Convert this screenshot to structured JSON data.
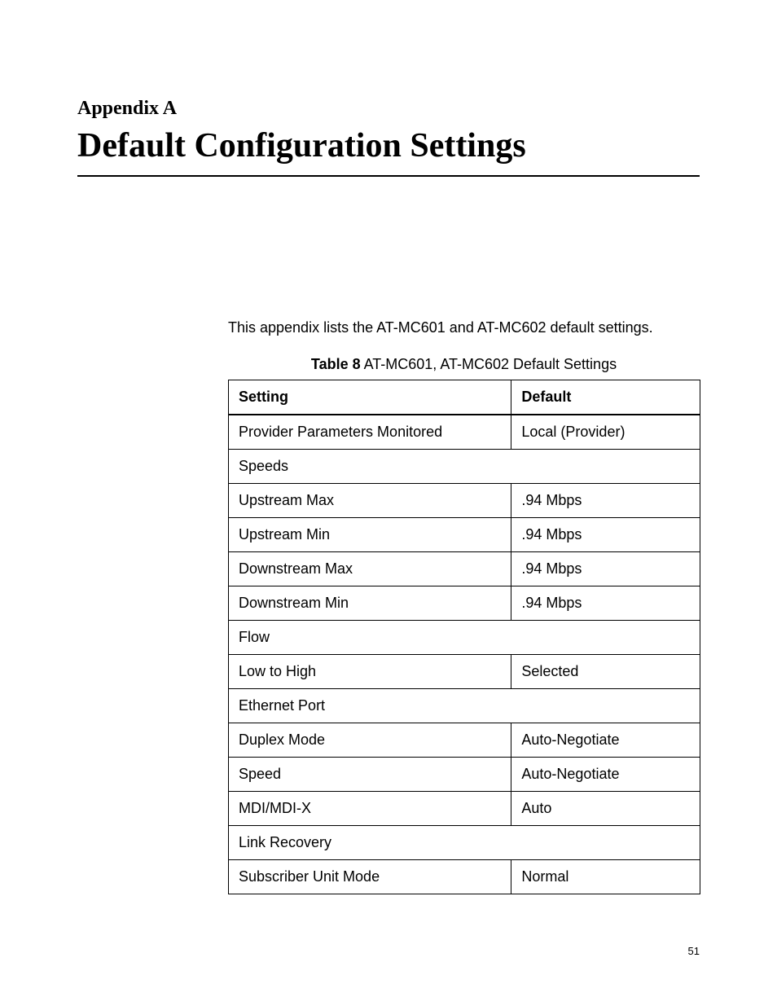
{
  "header": {
    "appendix_label": "Appendix A",
    "main_title": "Default Configuration Settings"
  },
  "intro_text": "This appendix lists the AT-MC601 and AT-MC602 default settings.",
  "table": {
    "caption_label": "Table 8",
    "caption_text": "  AT-MC601, AT-MC602 Default Settings",
    "headers": {
      "setting": "Setting",
      "default": "Default"
    },
    "rows": [
      {
        "setting": "Provider Parameters Monitored",
        "default": "Local (Provider)",
        "span": false
      },
      {
        "setting": "Speeds",
        "default": "",
        "span": true
      },
      {
        "setting": "Upstream Max",
        "default": ".94 Mbps",
        "span": false
      },
      {
        "setting": "Upstream Min",
        "default": ".94 Mbps",
        "span": false
      },
      {
        "setting": "Downstream Max",
        "default": ".94 Mbps",
        "span": false
      },
      {
        "setting": "Downstream Min",
        "default": ".94 Mbps",
        "span": false
      },
      {
        "setting": "Flow",
        "default": "",
        "span": true
      },
      {
        "setting": "Low to High",
        "default": "Selected",
        "span": false
      },
      {
        "setting": "Ethernet Port",
        "default": "",
        "span": true
      },
      {
        "setting": "Duplex Mode",
        "default": "Auto-Negotiate",
        "span": false
      },
      {
        "setting": "Speed",
        "default": "Auto-Negotiate",
        "span": false
      },
      {
        "setting": "MDI/MDI-X",
        "default": "Auto",
        "span": false
      },
      {
        "setting": "Link Recovery",
        "default": "",
        "span": true
      },
      {
        "setting": "Subscriber Unit Mode",
        "default": "Normal",
        "span": false
      }
    ]
  },
  "page_number": "51"
}
